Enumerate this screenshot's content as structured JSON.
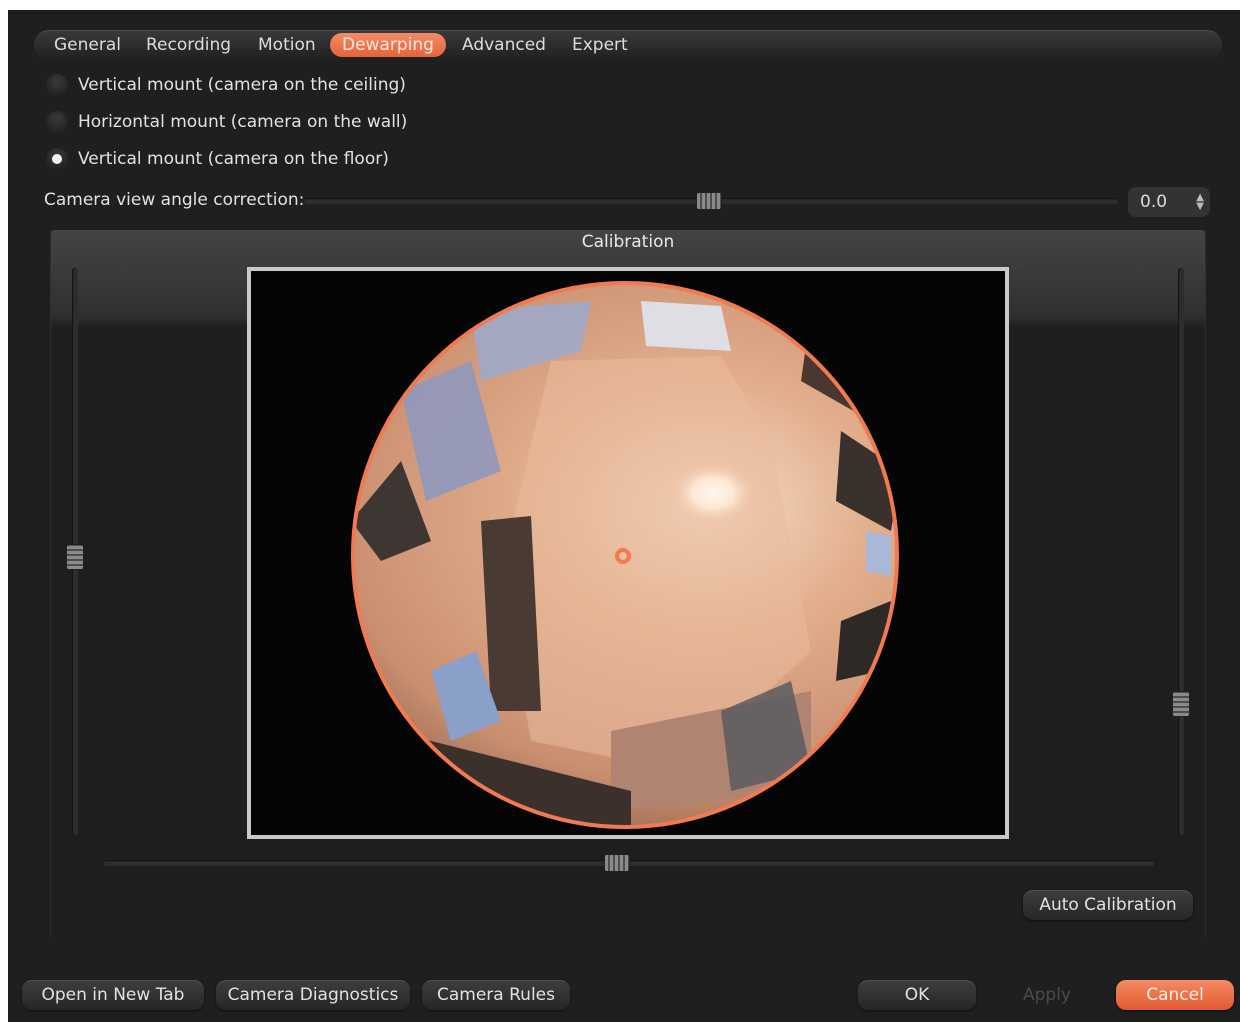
{
  "tabs": {
    "general": "General",
    "recording": "Recording",
    "motion": "Motion",
    "dewarping": "Dewarping",
    "advanced": "Advanced",
    "expert": "Expert",
    "active": "Dewarping"
  },
  "mount": {
    "options": [
      "Vertical mount (camera on the ceiling)",
      "Horizontal mount (camera on the wall)",
      "Vertical mount (camera on the floor)"
    ],
    "selected_index": 2
  },
  "angle_correction": {
    "label": "Camera view angle correction:",
    "value": "0.0"
  },
  "calibration": {
    "title": "Calibration",
    "auto_button": "Auto Calibration",
    "accent_color": "#f07a52"
  },
  "footer": {
    "open_new_tab": "Open in New Tab",
    "diagnostics": "Camera Diagnostics",
    "rules": "Camera Rules",
    "ok": "OK",
    "apply": "Apply",
    "cancel": "Cancel"
  }
}
